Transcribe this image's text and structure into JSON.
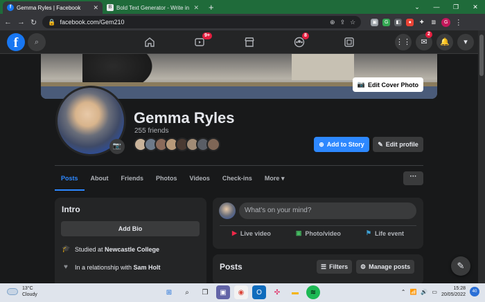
{
  "browser": {
    "tabs": [
      {
        "title": "Gemma Ryles | Facebook",
        "active": true
      },
      {
        "title": "Bold Text Generator - Write in B",
        "active": false
      }
    ],
    "url": "facebook.com/Gem210",
    "profile_initial": "G"
  },
  "fb_nav": {
    "watch_badge": "9+",
    "groups_badge": "8",
    "messenger_badge": "2"
  },
  "cover": {
    "edit_cover_label": "Edit Cover Photo"
  },
  "profile": {
    "name": "Gemma Ryles",
    "friends_count": "255 friends",
    "add_story_label": "Add to Story",
    "edit_profile_label": "Edit profile"
  },
  "tabs": [
    "Posts",
    "About",
    "Friends",
    "Photos",
    "Videos",
    "Check-ins",
    "More"
  ],
  "more_menu_label": "···",
  "intro": {
    "title": "Intro",
    "add_bio_label": "Add Bio",
    "studied_prefix": "Studied at ",
    "studied_place": "Newcastle College",
    "relationship_prefix": "In a relationship with ",
    "relationship_person": "Sam Holt"
  },
  "composer": {
    "placeholder": "What's on your mind?",
    "live_video": "Live video",
    "photo_video": "Photo/video",
    "life_event": "Life event"
  },
  "posts": {
    "title": "Posts",
    "filters_label": "Filters",
    "manage_label": "Manage posts"
  },
  "taskbar": {
    "temperature": "13°C",
    "condition": "Cloudy",
    "time": "15:28",
    "date": "20/05/2022",
    "notification_count": "40"
  }
}
